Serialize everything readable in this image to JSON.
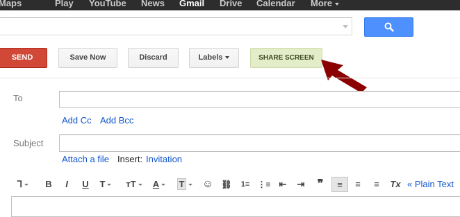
{
  "nav": {
    "items": [
      "Maps",
      "Play",
      "YouTube",
      "News",
      "Gmail",
      "Drive",
      "Calendar",
      "More"
    ],
    "active": "Gmail"
  },
  "search": {
    "placeholder": "",
    "button_icon": "search-icon"
  },
  "compose_toolbar": {
    "send": "SEND",
    "save_now": "Save Now",
    "discard": "Discard",
    "labels": "Labels",
    "share_screen": "SHARE SCREEN"
  },
  "fields": {
    "to_label": "To",
    "add_cc": "Add Cc",
    "add_bcc": "Add Bcc",
    "subject_label": "Subject",
    "attach_file": "Attach a file",
    "insert_label": "Insert:",
    "invitation": "Invitation"
  },
  "format_toolbar": {
    "font": "Ꞁ",
    "bold": "B",
    "italic": "I",
    "underline": "U",
    "font_size": "T",
    "size_alt": "тT",
    "text_color": "A",
    "highlight": "T",
    "emoji": "☺",
    "link": "⛓",
    "numbered_list": "1≡",
    "bulleted_list": "⋮≡",
    "indent_less": "⇤",
    "indent_more": "⇥",
    "quote": "❞",
    "align_left": "≡",
    "align_center": "≡",
    "align_right": "≡",
    "remove_format": "Tx",
    "plain_text": "« Plain Text"
  },
  "colors": {
    "topbar": "#2d2d2d",
    "send_red": "#d14836",
    "search_blue": "#4d90fe",
    "share_green": "#e4edc9",
    "arrow_red": "#8b0000",
    "link_blue": "#1155cc"
  }
}
